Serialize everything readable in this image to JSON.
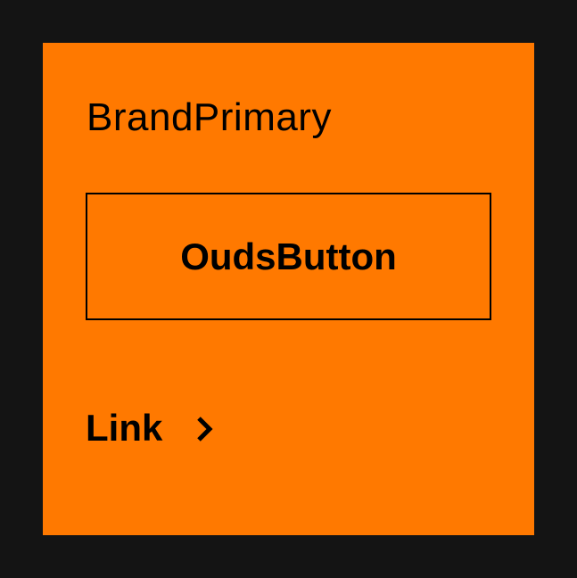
{
  "colors": {
    "background": "#141414",
    "brand_primary": "#FF7900",
    "foreground": "#000000"
  },
  "card": {
    "title": "BrandPrimary"
  },
  "button": {
    "label": "OudsButton"
  },
  "link": {
    "label": "Link",
    "icon": "chevron-right-icon"
  }
}
